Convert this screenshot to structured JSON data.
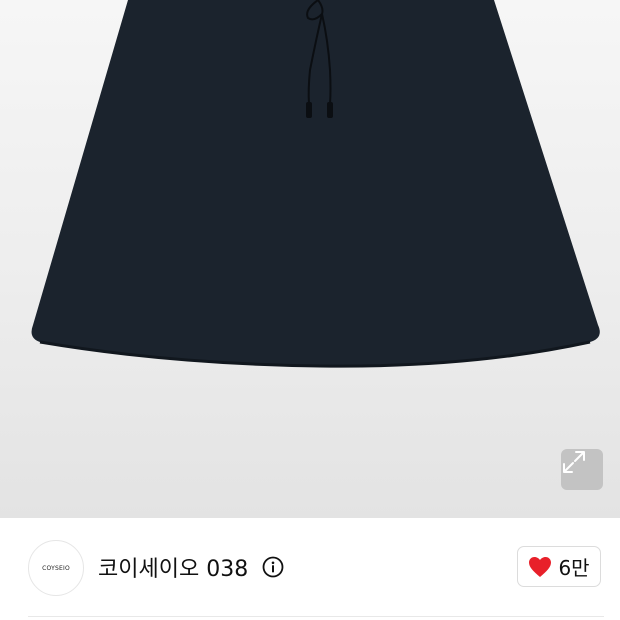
{
  "product": {
    "image_icon": "skirt-image",
    "expand_icon": "expand-arrows-icon"
  },
  "brand": {
    "logo_text": "COYSEIO",
    "name": "코이세이오 038",
    "info_icon": "info-icon"
  },
  "like": {
    "icon": "heart-icon",
    "color": "#e8202a",
    "count": "6만"
  }
}
